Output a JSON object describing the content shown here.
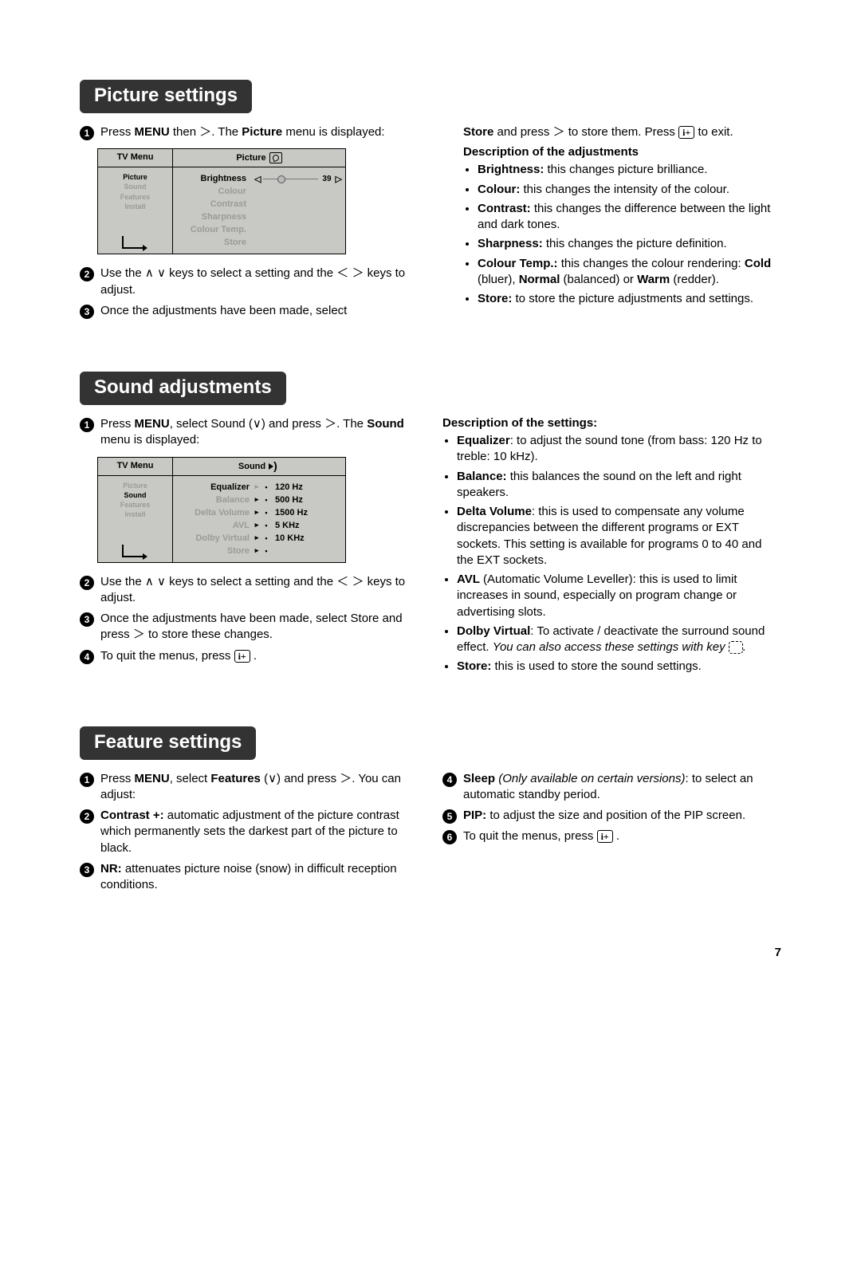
{
  "page_number": "7",
  "section1": {
    "title": "Picture settings",
    "step1_a": "Press ",
    "step1_menu": "MENU",
    "step1_b": " then ＞. The ",
    "step1_picture": "Picture",
    "step1_c": " menu is displayed:",
    "menu": {
      "tl": "TV Menu",
      "tr": "Picture",
      "left_items": [
        "Picture",
        "Sound",
        "Features",
        "Install"
      ],
      "right_items": [
        "Brightness",
        "Colour",
        "Contrast",
        "Sharpness",
        "Colour Temp.",
        "Store"
      ],
      "value": "39"
    },
    "step2": "Use the ∧ ∨ keys to select a setting and the ＜ ＞ keys to adjust.",
    "step3": "Once the adjustments have been made, select",
    "right_continue_a": "Store",
    "right_continue_b": " and press ＞ to store them. Press ",
    "right_continue_c": " to exit.",
    "desc_head": "Description of the adjustments",
    "desc": [
      {
        "b": "Brightness:",
        "t": " this changes picture brilliance."
      },
      {
        "b": "Colour:",
        "t": " this changes the intensity of the colour."
      },
      {
        "b": "Contrast:",
        "t": " this changes the difference between the light and dark tones."
      },
      {
        "b": "Sharpness:",
        "t": " this changes the picture definition."
      },
      {
        "b": "Colour Temp.:",
        "t": " this changes the colour rendering: ",
        "extra": "Cold (bluer), Normal (balanced) or Warm (redder)."
      },
      {
        "b": "Store:",
        "t": " to store the picture adjustments and settings."
      }
    ]
  },
  "section2": {
    "title": "Sound adjustments",
    "step1_a": "Press ",
    "step1_b": ", select Sound (∨) and press ＞. The ",
    "step1_c": " menu is displayed:",
    "step1_menu": "MENU",
    "step1_sound": "Sound",
    "menu": {
      "tl": "TV Menu",
      "tr": "Sound",
      "left_items": [
        "Picture",
        "Sound",
        "Features",
        "Install"
      ],
      "right_items": [
        "Equalizer",
        "Balance",
        "Delta Volume",
        "AVL",
        "Dolby Virtual",
        "Store"
      ],
      "freqs": [
        "120 Hz",
        "500 Hz",
        "1500 Hz",
        "5 KHz",
        "10 KHz"
      ]
    },
    "step2": "Use the ∧ ∨ keys to select a setting and the ＜ ＞ keys to adjust.",
    "step3": "Once the adjustments have been made, select Store and press ＞ to store these changes.",
    "step4": "To quit the menus, press ",
    "desc_head": "Description of the settings:",
    "desc": [
      {
        "b": "Equalizer",
        "t": ": to adjust the sound tone (from bass: 120 Hz to treble: 10 kHz)."
      },
      {
        "b": "Balance:",
        "t": " this balances the sound on the left and right speakers."
      },
      {
        "b": "Delta Volume",
        "t": ": this is used to compensate any volume discrepancies between the different programs or EXT sockets. This setting is available for programs 0 to 40 and the EXT sockets."
      },
      {
        "b": "AVL",
        "t": " (Automatic Volume Leveller): this is used to limit increases in sound, especially on program change or advertising slots."
      },
      {
        "b": "Dolby Virtual",
        "t": ": To activate / deactivate the surround sound effect. ",
        "i": "You can also access these settings with key ",
        "after_icon": "."
      },
      {
        "b": "Store:",
        "t": " this is used to store the sound settings."
      }
    ]
  },
  "section3": {
    "title": "Feature settings",
    "step1_a": "Press ",
    "step1_menu": "MENU",
    "step1_b": ", select ",
    "step1_features": "Features",
    "step1_c": " (∨) and press ＞. You can adjust:",
    "step2_b": "Contrast +:",
    "step2_t": " automatic adjustment of the picture contrast which permanently sets the darkest part of the picture to black.",
    "step3_b": "NR:",
    "step3_t": " attenuates picture noise (snow) in difficult reception conditions.",
    "step4_b": "Sleep",
    "step4_i": " (Only available on certain versions)",
    "step4_t": ": to select an automatic standby period.",
    "step5_b": "PIP:",
    "step5_t": " to adjust the size and position of the PIP screen.",
    "step6": "To quit the menus, press "
  },
  "exit_key": "i+"
}
